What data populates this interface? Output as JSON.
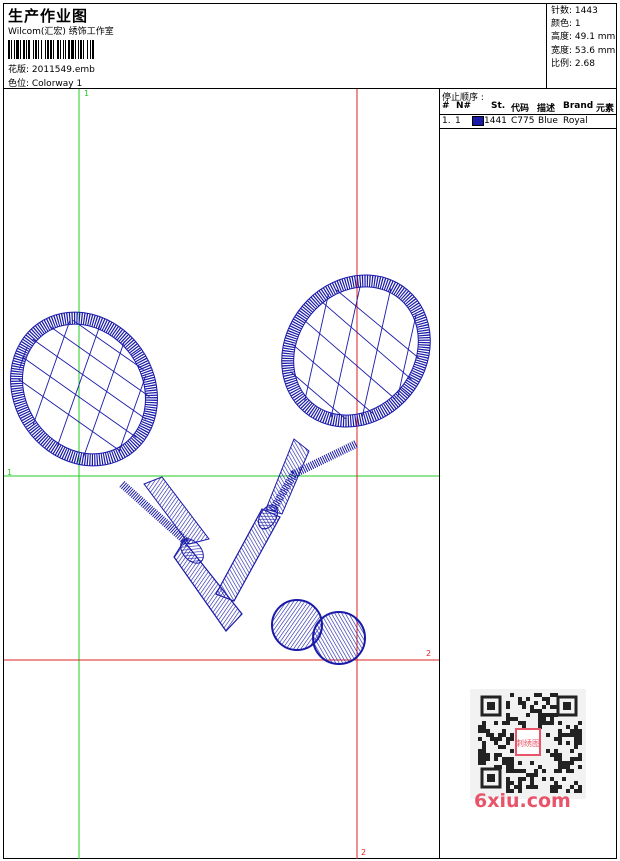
{
  "header": {
    "title": "生产作业图",
    "subtitle": "Wilcom(汇宏) 绣饰工作室",
    "design_label": "花版: 2011549.emb",
    "colorway_label": "色位: Colorway 1"
  },
  "stats": {
    "stitches": "针数: 1443",
    "colors": "颜色: 1",
    "height": "高度: 49.1 mm",
    "width": "宽度: 53.6 mm",
    "scale": "比例: 2.68"
  },
  "stop_sequence": {
    "title": "停止顺序 :",
    "headers": [
      "#",
      "N#",
      "St.",
      "代码",
      "描述",
      "Brand",
      "元素"
    ],
    "rows": [
      {
        "num": "1.",
        "n": "1",
        "stitches": "1441",
        "code": "C775",
        "desc": "Blue",
        "brand": "Royal",
        "color": "#1a1aa8"
      }
    ]
  },
  "guides": {
    "green_top": "1",
    "green_left": "1",
    "red_right": "2",
    "red_bottom": "2"
  },
  "colors": {
    "thread": "#1a1aa8",
    "guide_green": "#22cc22",
    "guide_red": "#dd2222",
    "watermark": "#e8546a"
  },
  "watermark": {
    "label": "6xiu.com",
    "stamp_text": "刺绣图"
  }
}
